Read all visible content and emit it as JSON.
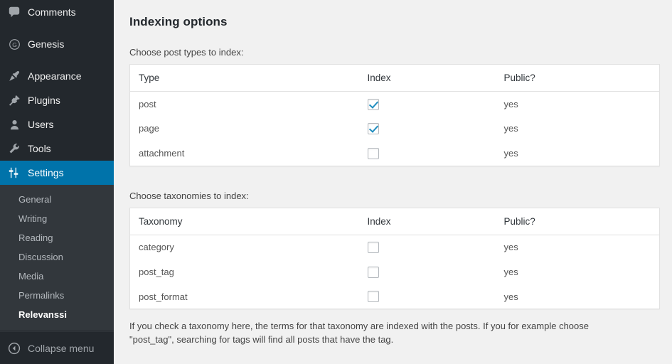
{
  "sidebar": {
    "items": [
      {
        "label": "Comments",
        "icon": "comments-icon"
      },
      {
        "label": "Genesis",
        "icon": "genesis-icon"
      },
      {
        "label": "Appearance",
        "icon": "appearance-icon"
      },
      {
        "label": "Plugins",
        "icon": "plugins-icon"
      },
      {
        "label": "Users",
        "icon": "users-icon"
      },
      {
        "label": "Tools",
        "icon": "tools-icon"
      },
      {
        "label": "Settings",
        "icon": "settings-icon"
      }
    ],
    "submenu": [
      {
        "label": "General"
      },
      {
        "label": "Writing"
      },
      {
        "label": "Reading"
      },
      {
        "label": "Discussion"
      },
      {
        "label": "Media"
      },
      {
        "label": "Permalinks"
      },
      {
        "label": "Relevanssi"
      }
    ],
    "active_submenu": "Relevanssi",
    "collapse": {
      "label": "Collapse menu",
      "icon": "collapse-arrow-icon"
    },
    "accent_color": "#0073aa",
    "background_color": "#23282d",
    "submenu_background_color": "#32373c"
  },
  "main": {
    "title": "Indexing options",
    "post_types_label": "Choose post types to index:",
    "taxonomies_label": "Choose taxonomies to index:",
    "post_types_table": {
      "headers": [
        "Type",
        "Index",
        "Public?"
      ],
      "rows": [
        {
          "name": "post",
          "index": true,
          "public": "yes"
        },
        {
          "name": "page",
          "index": true,
          "public": "yes"
        },
        {
          "name": "attachment",
          "index": false,
          "public": "yes"
        }
      ]
    },
    "taxonomies_table": {
      "headers": [
        "Taxonomy",
        "Index",
        "Public?"
      ],
      "rows": [
        {
          "name": "category",
          "index": false,
          "public": "yes"
        },
        {
          "name": "post_tag",
          "index": false,
          "public": "yes"
        },
        {
          "name": "post_format",
          "index": false,
          "public": "yes"
        }
      ]
    },
    "help_text": "If you check a taxonomy here, the terms for that taxonomy are indexed with the posts. If you for example choose \"post_tag\", searching for tags will find all posts that have the tag."
  }
}
